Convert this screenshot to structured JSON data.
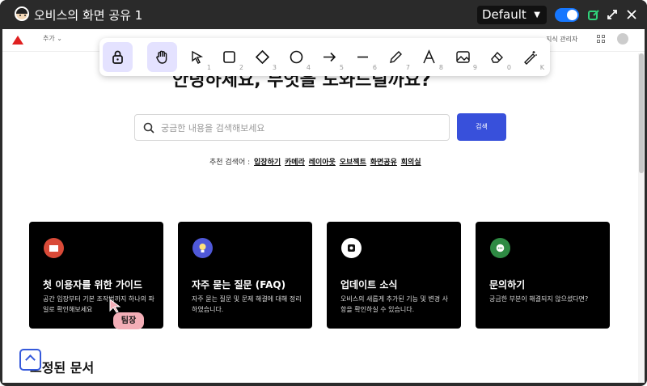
{
  "window": {
    "title": "오비스의 화면 공유 1",
    "preset": "Default",
    "share_enabled": true
  },
  "toolbar": {
    "tools": [
      {
        "name": "lock",
        "key": ""
      },
      {
        "name": "hand",
        "key": ""
      },
      {
        "name": "selection",
        "key": "1"
      },
      {
        "name": "rectangle",
        "key": "2"
      },
      {
        "name": "diamond",
        "key": "3"
      },
      {
        "name": "ellipse",
        "key": "4"
      },
      {
        "name": "arrow",
        "key": "5"
      },
      {
        "name": "line",
        "key": "6"
      },
      {
        "name": "draw",
        "key": "7"
      },
      {
        "name": "text",
        "key": "8"
      },
      {
        "name": "image",
        "key": "9"
      },
      {
        "name": "eraser",
        "key": "0"
      },
      {
        "name": "magic-wand",
        "key": "K"
      }
    ]
  },
  "header": {
    "add_menu": "추가",
    "right_menu": "지식 관리자"
  },
  "hero": {
    "title": "안녕하세요, 무엇을 도와드릴까요?"
  },
  "search": {
    "placeholder": "궁금한 내용을 검색해보세요",
    "button": "검색",
    "recommend_label": "추천 검색어 :",
    "keywords": [
      "입장하기",
      "카메라",
      "레이아웃",
      "오브젝트",
      "화면공유",
      "회의실"
    ]
  },
  "cards": [
    {
      "title": "첫 이용자를 위한 가이드",
      "desc": "공간 입장부터 기본 조작법까지 하나의 파일로 확인해보세요",
      "color": "#d94a38"
    },
    {
      "title": "자주 묻는 질문 (FAQ)",
      "desc": "자주 묻는 질문 및 문제 해결에 대해 정리하였습니다.",
      "color": "#4f58d8"
    },
    {
      "title": "업데이트 소식",
      "desc": "오비스의 새롭게 추가된 기능 및 변경 사항을 확인하실 수 있습니다.",
      "color": "#ffffff"
    },
    {
      "title": "문의하기",
      "desc": "궁금한 부분이 해결되지 않으셨다면?",
      "color": "#2e8a43"
    }
  ],
  "tooltip": "팀장",
  "section": {
    "title": "고정된 문서"
  }
}
